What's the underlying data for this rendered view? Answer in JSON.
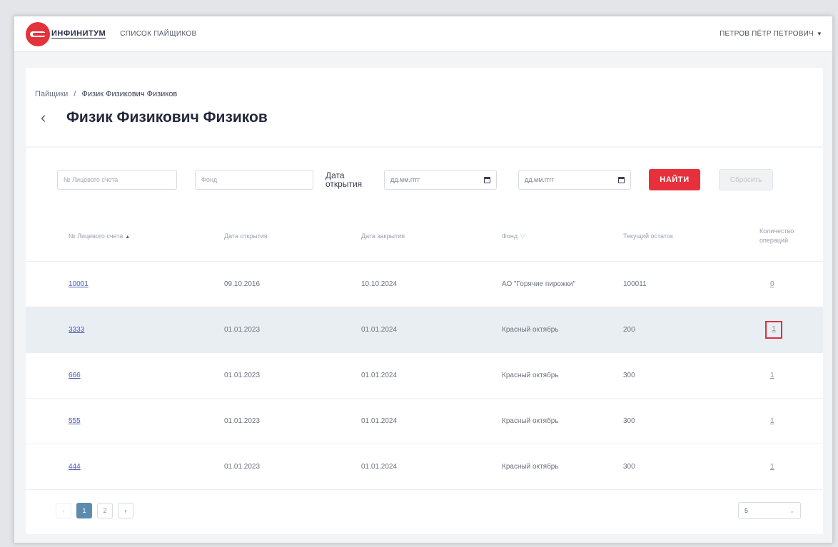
{
  "header": {
    "logo_text": "ИНФИНИТУМ",
    "nav_link": "СПИСОК ПАЙЩИКОВ",
    "user_name": "ПЕТРОВ ПЁТР ПЕТРОВИЧ"
  },
  "breadcrumb": {
    "root": "Пайщики",
    "separator": "/",
    "current": "Физик Физикович Физиков"
  },
  "page_title": "Физик Физикович Физиков",
  "filters": {
    "account_placeholder": "№ Лицевого счета",
    "fund_placeholder": "Фонд",
    "date_label": "Дата открытия",
    "date_from_placeholder": "дд.мм.гггг",
    "date_to_placeholder": "дд.мм.гггг",
    "find_label": "НАЙТИ",
    "reset_label": "Сбросить"
  },
  "table": {
    "columns": [
      "№ Лицевого счета",
      "Дата открытия",
      "Дата закрытия",
      "Фонд",
      "Текущий остаток",
      "Количество операций"
    ],
    "rows": [
      {
        "account": "10001",
        "opened": "09.10.2016",
        "closed": "10.10.2024",
        "fund": "АО \"Горячие пирожки\"",
        "balance": "100011",
        "ops": "0"
      },
      {
        "account": "3333",
        "opened": "01.01.2023",
        "closed": "01.01.2024",
        "fund": "Красный октябрь",
        "balance": "200",
        "ops": "1"
      },
      {
        "account": "666",
        "opened": "01.01.2023",
        "closed": "01.01.2024",
        "fund": "Красный октябрь",
        "balance": "300",
        "ops": "1"
      },
      {
        "account": "555",
        "opened": "01.01.2023",
        "closed": "01.01.2024",
        "fund": "Красный октябрь",
        "balance": "300",
        "ops": "1"
      },
      {
        "account": "444",
        "opened": "01.01.2023",
        "closed": "01.01.2024",
        "fund": "Красный октябрь",
        "balance": "300",
        "ops": "1"
      }
    ]
  },
  "pagination": {
    "prev": "‹",
    "pages": [
      "1",
      "2"
    ],
    "next": "›",
    "page_size": "5"
  }
}
